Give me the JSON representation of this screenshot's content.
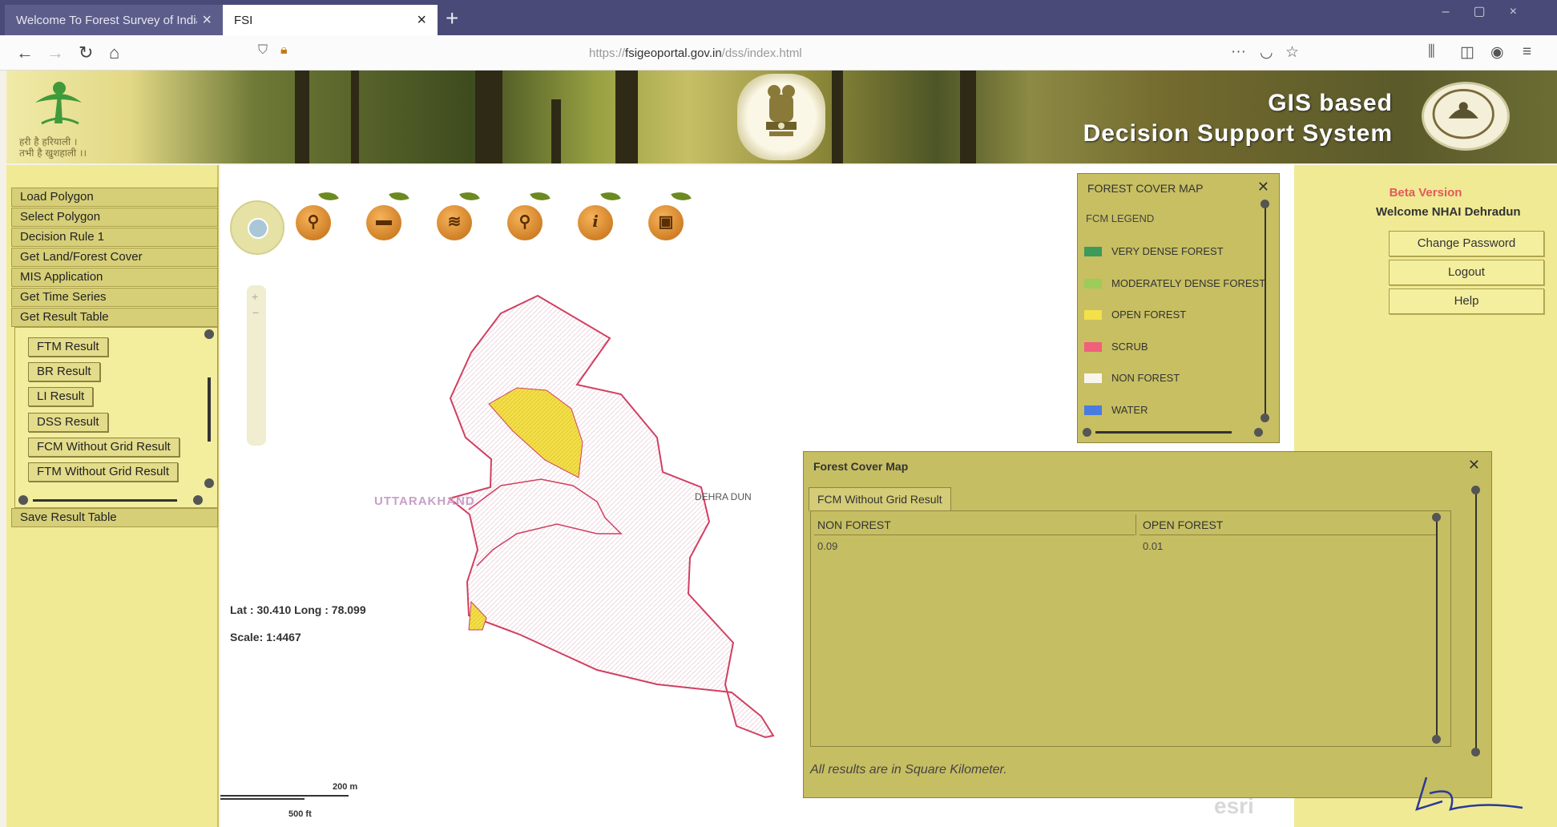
{
  "browser": {
    "tabs": [
      {
        "title": "Welcome To Forest Survey of India",
        "active": false
      },
      {
        "title": "FSI",
        "active": true
      }
    ],
    "new_tab": "+",
    "url_scheme": "https://",
    "url_host": "fsigeoportal.gov.in",
    "url_path": "/dss/index.html",
    "menu_dots": "···"
  },
  "banner": {
    "slogan_line1": "हरी है हरियाली ।",
    "slogan_line2": "तभी है खुशहाली ।।",
    "title_line1": "GIS based",
    "title_line2": "Decision Support System"
  },
  "left_menu": {
    "items": [
      "Load Polygon",
      "Select Polygon",
      "Decision Rule 1",
      "Get Land/Forest Cover",
      "MIS Application",
      "Get Time Series",
      "Get Result Table"
    ],
    "results": [
      "FTM Result",
      "BR Result",
      "LI Result",
      "DSS Result",
      "FCM Without Grid Result",
      "FTM Without Grid Result"
    ],
    "save": "Save Result Table"
  },
  "map": {
    "tools": [
      "locate-tool",
      "bookmark-tool",
      "layers-tool",
      "search-tool",
      "info-tool",
      "print-tool"
    ],
    "coord": "Lat : 30.410 Long : 78.099",
    "scale": "Scale: 1:4467",
    "label_state": "UTTARAKHAND",
    "label_district": "DEHRA DUN",
    "scalebar_m": "200 m",
    "scalebar_ft": "500 ft",
    "attribution": "esri"
  },
  "legend": {
    "title": "FOREST COVER MAP",
    "subtitle": "FCM LEGEND",
    "items": [
      {
        "label": "VERY DENSE FOREST",
        "color": "#3c9a5a"
      },
      {
        "label": "MODERATELY DENSE FOREST",
        "color": "#9ccc5a"
      },
      {
        "label": "OPEN FOREST",
        "color": "#f4e04a"
      },
      {
        "label": "SCRUB",
        "color": "#f0607a"
      },
      {
        "label": "NON FOREST",
        "color": "#f8f6ec"
      },
      {
        "label": "WATER",
        "color": "#4a7be0"
      }
    ]
  },
  "right_panel": {
    "beta": "Beta Version",
    "welcome": "Welcome NHAI Dehradun",
    "buttons": [
      "Change Password",
      "Logout",
      "Help"
    ]
  },
  "dialog": {
    "title": "Forest Cover Map",
    "tab": "FCM Without Grid Result",
    "columns": [
      "NON FOREST",
      "OPEN FOREST"
    ],
    "row": [
      "0.09",
      "0.01"
    ],
    "note": "All results are in Square Kilometer."
  },
  "colors": {
    "panel_bg": "#f0ea94",
    "dialog_bg": "#c6be62",
    "beta_red": "#e35a5a",
    "open_forest": "#f4e04a",
    "boundary": "#d04060"
  }
}
